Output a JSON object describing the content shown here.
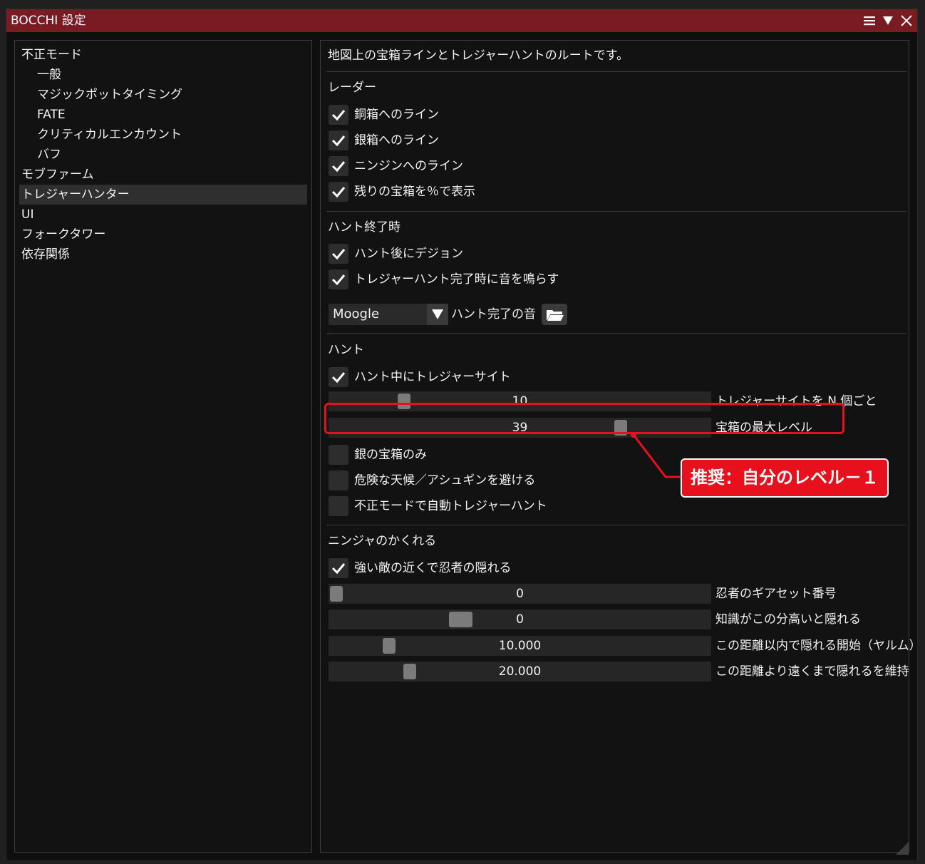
{
  "window": {
    "title": "BOCCHI 設定"
  },
  "sidebar": {
    "items": [
      {
        "label": "不正モード"
      },
      {
        "label": "一般"
      },
      {
        "label": "マジックポットタイミング"
      },
      {
        "label": "FATE"
      },
      {
        "label": "クリティカルエンカウント"
      },
      {
        "label": "バフ"
      },
      {
        "label": "モブファーム"
      },
      {
        "label": "トレジャーハンター"
      },
      {
        "label": "UI"
      },
      {
        "label": "フォークタワー"
      },
      {
        "label": "依存関係"
      }
    ],
    "selected": "トレジャーハンター"
  },
  "content": {
    "description": "地図上の宝箱ラインとトレジャーハントのルートです。",
    "radar": {
      "heading": "レーダー",
      "options": [
        {
          "label": "銅箱へのライン",
          "checked": true
        },
        {
          "label": "銀箱へのライン",
          "checked": true
        },
        {
          "label": "ニンジンへのライン",
          "checked": true
        },
        {
          "label": "残りの宝箱を％で表示",
          "checked": true
        }
      ]
    },
    "hunt_end": {
      "heading": "ハント終了時",
      "options": [
        {
          "label": "ハント後にデジョン",
          "checked": true
        },
        {
          "label": "トレジャーハント完了時に音を鳴らす",
          "checked": true
        }
      ],
      "sound_select": "Moogle",
      "sound_label": "ハント完了の音"
    },
    "hunt": {
      "heading": "ハント",
      "options": [
        {
          "label": "ハント中にトレジャーサイト",
          "checked": true
        }
      ],
      "sliders": [
        {
          "value": "10",
          "label": "トレジャーサイトを N 個ごと",
          "fraction": 0.2
        },
        {
          "value": "39",
          "label": "宝箱の最大レベル",
          "fraction": 0.76
        }
      ],
      "options2": [
        {
          "label": "銀の宝箱のみ",
          "checked": false
        },
        {
          "label": "危険な天候／アシュギンを避ける",
          "checked": false
        },
        {
          "label": "不正モードで自動トレジャーハント",
          "checked": false
        }
      ]
    },
    "ninja": {
      "heading": "ニンジャのかくれる",
      "options": [
        {
          "label": "強い敵の近くで忍者の隠れる",
          "checked": true
        }
      ],
      "sliders": [
        {
          "value": "0",
          "label": "忍者のギアセット番号",
          "fraction": 0.0
        },
        {
          "value": "0",
          "label": "知識がこの分高いと隠れる",
          "fraction": 0.34
        },
        {
          "value": "10.000",
          "label": "この距離以内で隠れる開始（ヤルム）",
          "fraction": 0.16
        },
        {
          "value": "20.000",
          "label": "この距離より遠くまで隠れるを維持",
          "fraction": 0.21
        }
      ]
    }
  },
  "annotation": {
    "callout": "推奨：自分のレベル－１",
    "color": "#e8101c"
  },
  "colors": {
    "titlebar": "#7a1a22",
    "background": "#121212",
    "control": "#2a2a2a"
  }
}
